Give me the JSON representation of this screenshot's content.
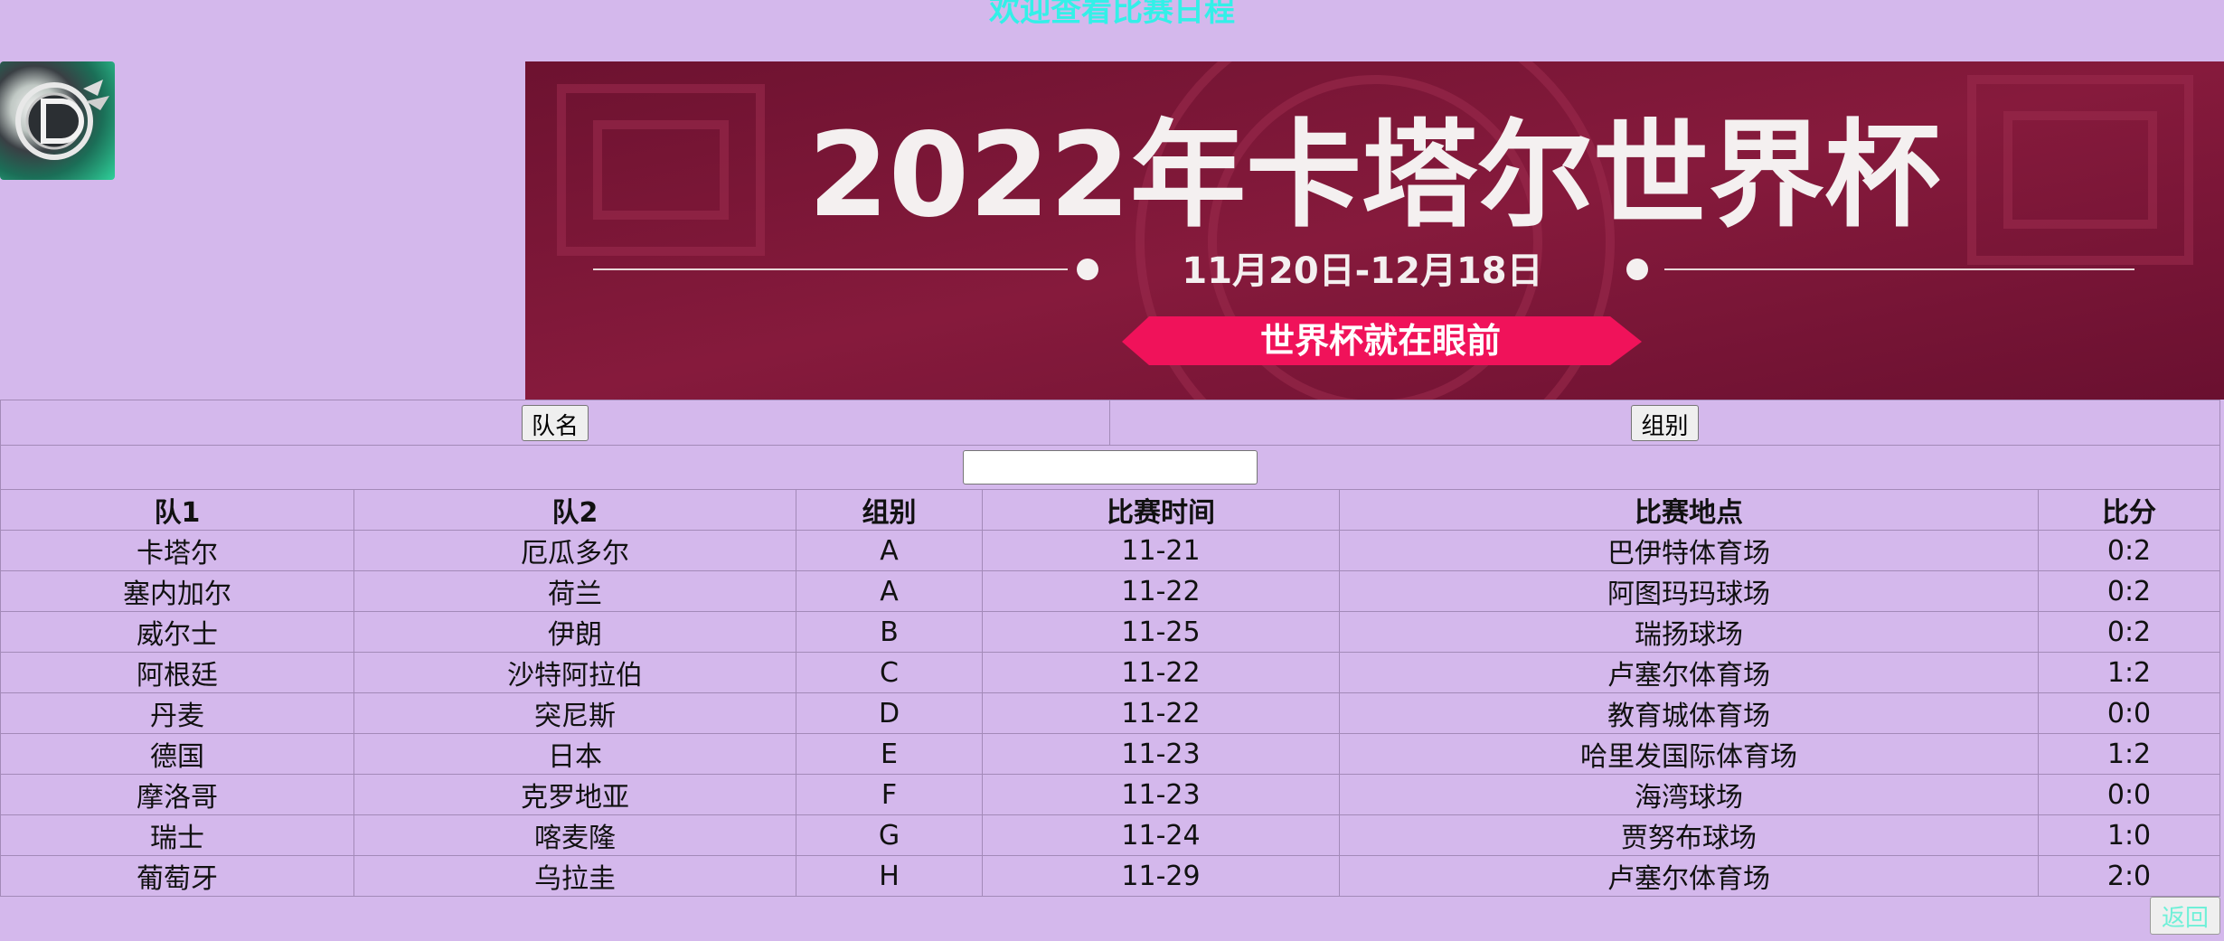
{
  "header": {
    "welcome": "欢迎查看比赛日程"
  },
  "banner": {
    "title": "2022年卡塔尔世界杯",
    "dates": "11月20日-12月18日",
    "tagline": "世界杯就在眼前"
  },
  "filters": {
    "team_button": "队名",
    "group_button": "组别",
    "search_value": ""
  },
  "table": {
    "headers": [
      "队1",
      "队2",
      "组别",
      "比赛时间",
      "比赛地点",
      "比分"
    ],
    "rows": [
      [
        "卡塔尔",
        "厄瓜多尔",
        "A",
        "11-21",
        "巴伊特体育场",
        "0:2"
      ],
      [
        "塞内加尔",
        "荷兰",
        "A",
        "11-22",
        "阿图玛玛球场",
        "0:2"
      ],
      [
        "威尔士",
        "伊朗",
        "B",
        "11-25",
        "瑞扬球场",
        "0:2"
      ],
      [
        "阿根廷",
        "沙特阿拉伯",
        "C",
        "11-22",
        "卢塞尔体育场",
        "1:2"
      ],
      [
        "丹麦",
        "突尼斯",
        "D",
        "11-22",
        "教育城体育场",
        "0:0"
      ],
      [
        "德国",
        "日本",
        "E",
        "11-23",
        "哈里发国际体育场",
        "1:2"
      ],
      [
        "摩洛哥",
        "克罗地亚",
        "F",
        "11-23",
        "海湾球场",
        "0:0"
      ],
      [
        "瑞士",
        "喀麦隆",
        "G",
        "11-24",
        "贾努布球场",
        "1:0"
      ],
      [
        "葡萄牙",
        "乌拉圭",
        "H",
        "11-29",
        "卢塞尔体育场",
        "2:0"
      ]
    ]
  },
  "footer": {
    "back_button": "返回"
  },
  "colors": {
    "background": "#d4b8ec",
    "welcome": "#33f0e8",
    "banner_bg": "#7b1534",
    "banner_pill": "#f0125a"
  }
}
